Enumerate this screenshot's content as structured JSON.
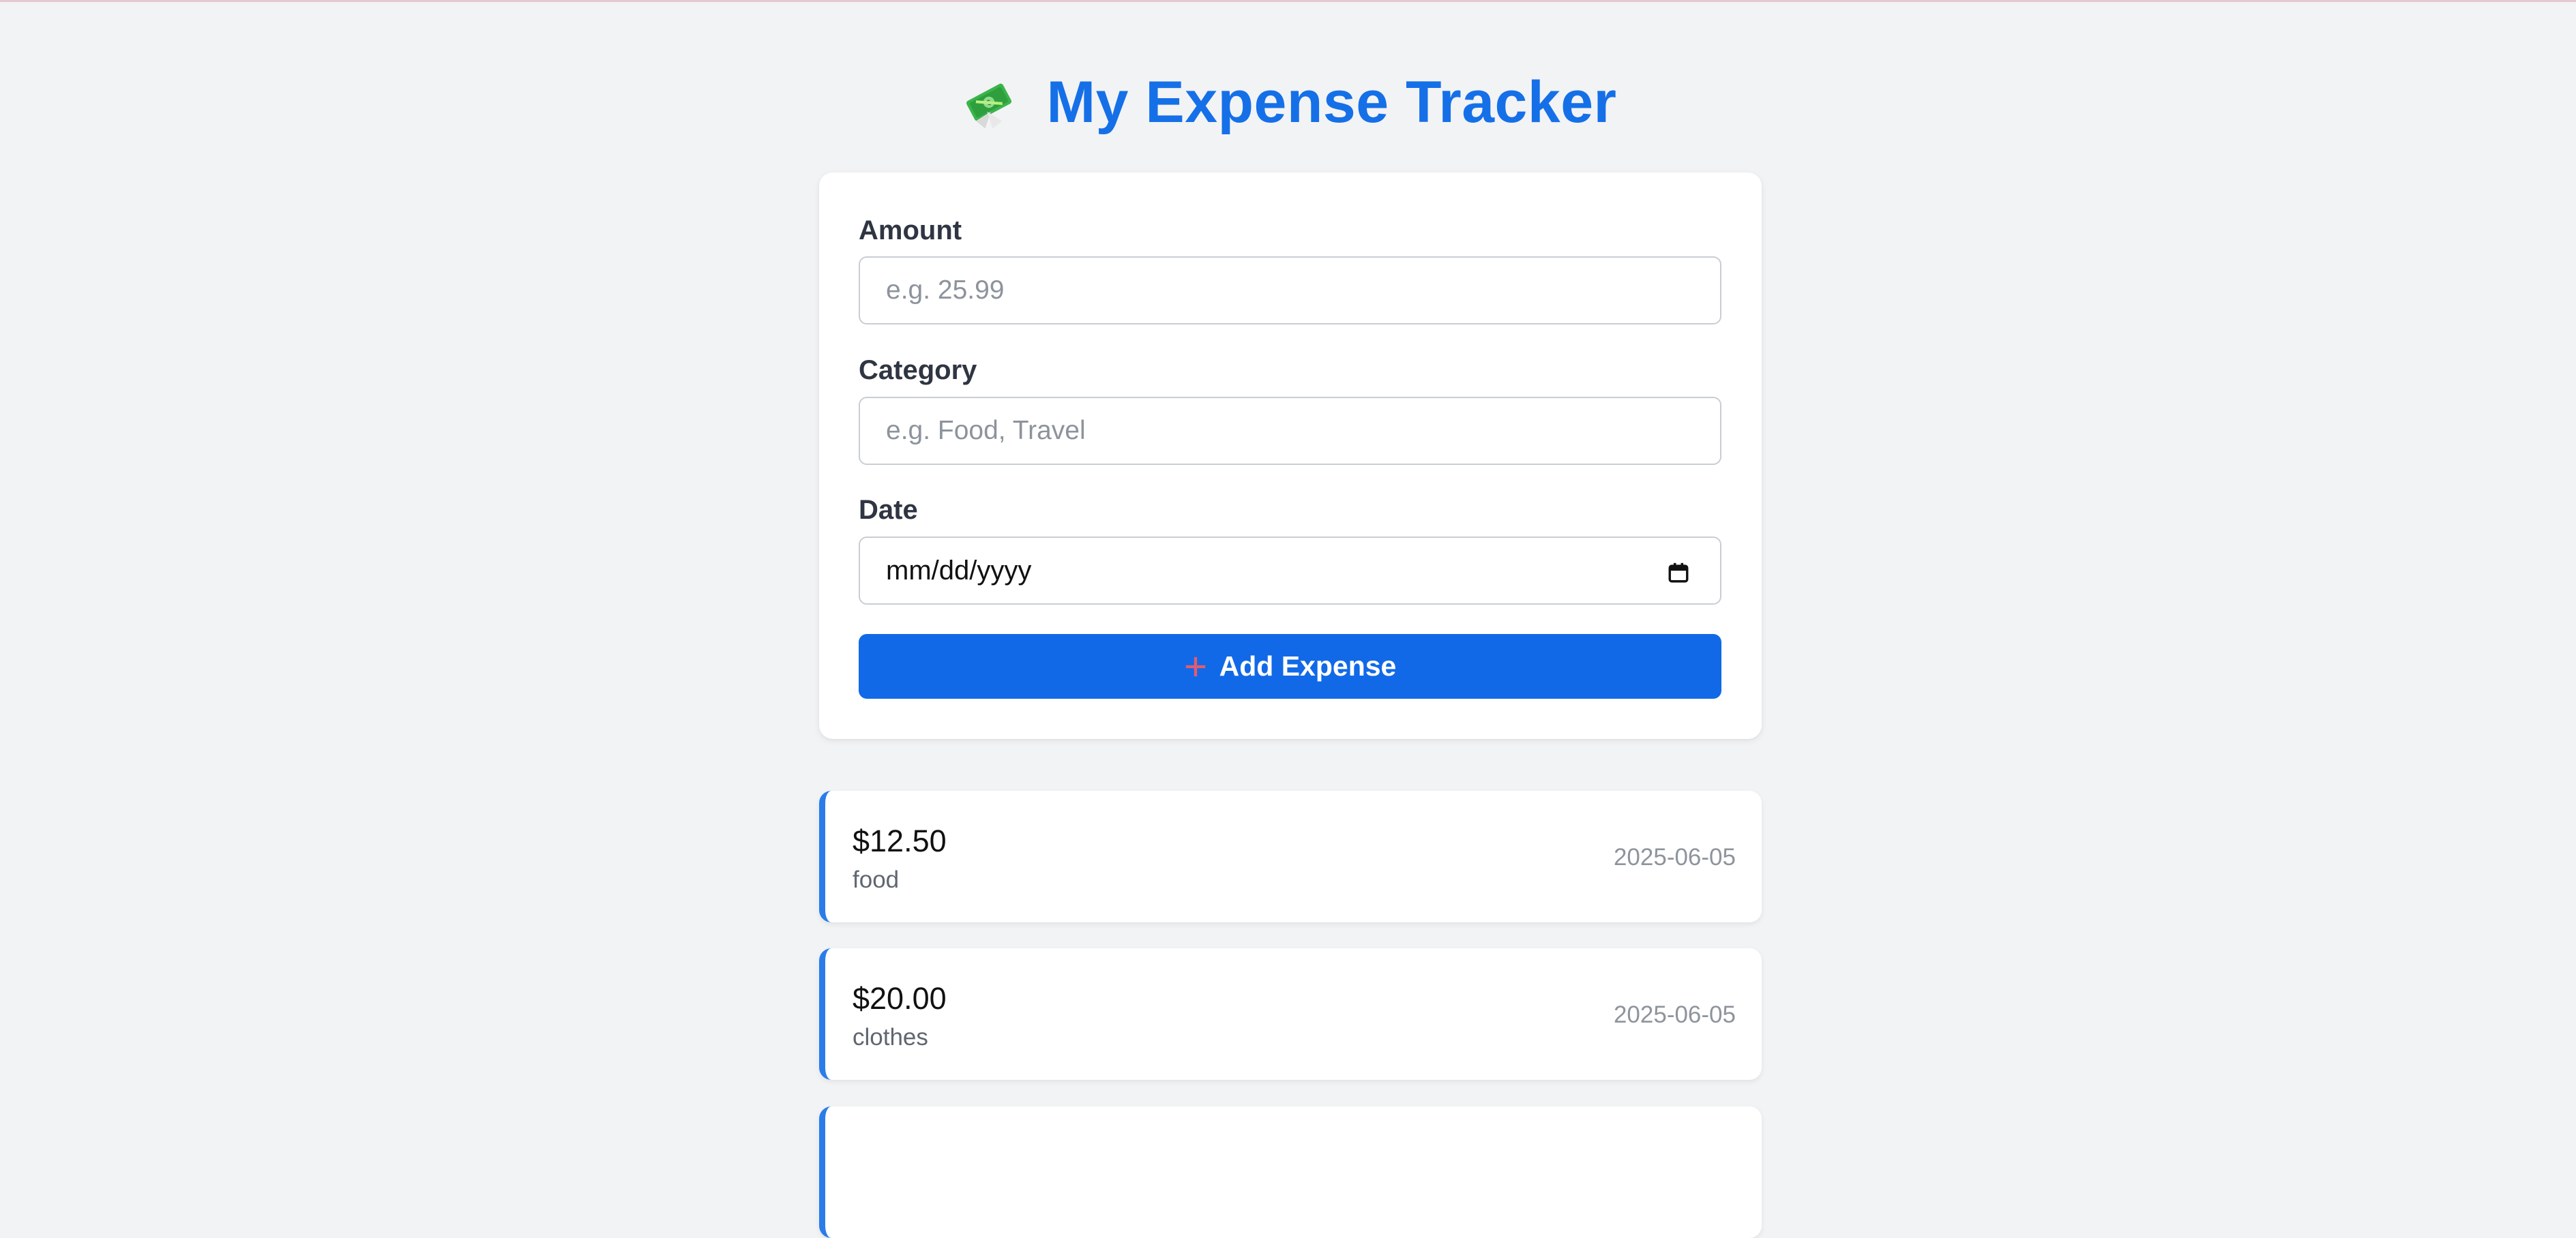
{
  "app": {
    "title": "My Expense Tracker"
  },
  "form": {
    "amount_label": "Amount",
    "amount_placeholder": "e.g. 25.99",
    "category_label": "Category",
    "category_placeholder": "e.g. Food, Travel",
    "date_label": "Date",
    "date_value": "mm/dd/yyyy",
    "add_button_label": "Add Expense"
  },
  "expenses": [
    {
      "amount": "$12.50",
      "category": "food",
      "date": "2025-06-05"
    },
    {
      "amount": "$20.00",
      "category": "clothes",
      "date": "2025-06-05"
    }
  ],
  "colors": {
    "accent": "#1169e8",
    "title": "#1570e8",
    "background": "#f2f3f5",
    "card_border_left": "#2a7de9"
  },
  "icons": {
    "title_icon": "money-with-wings-icon",
    "add_icon": "plus-icon",
    "date_icon": "calendar-icon"
  }
}
